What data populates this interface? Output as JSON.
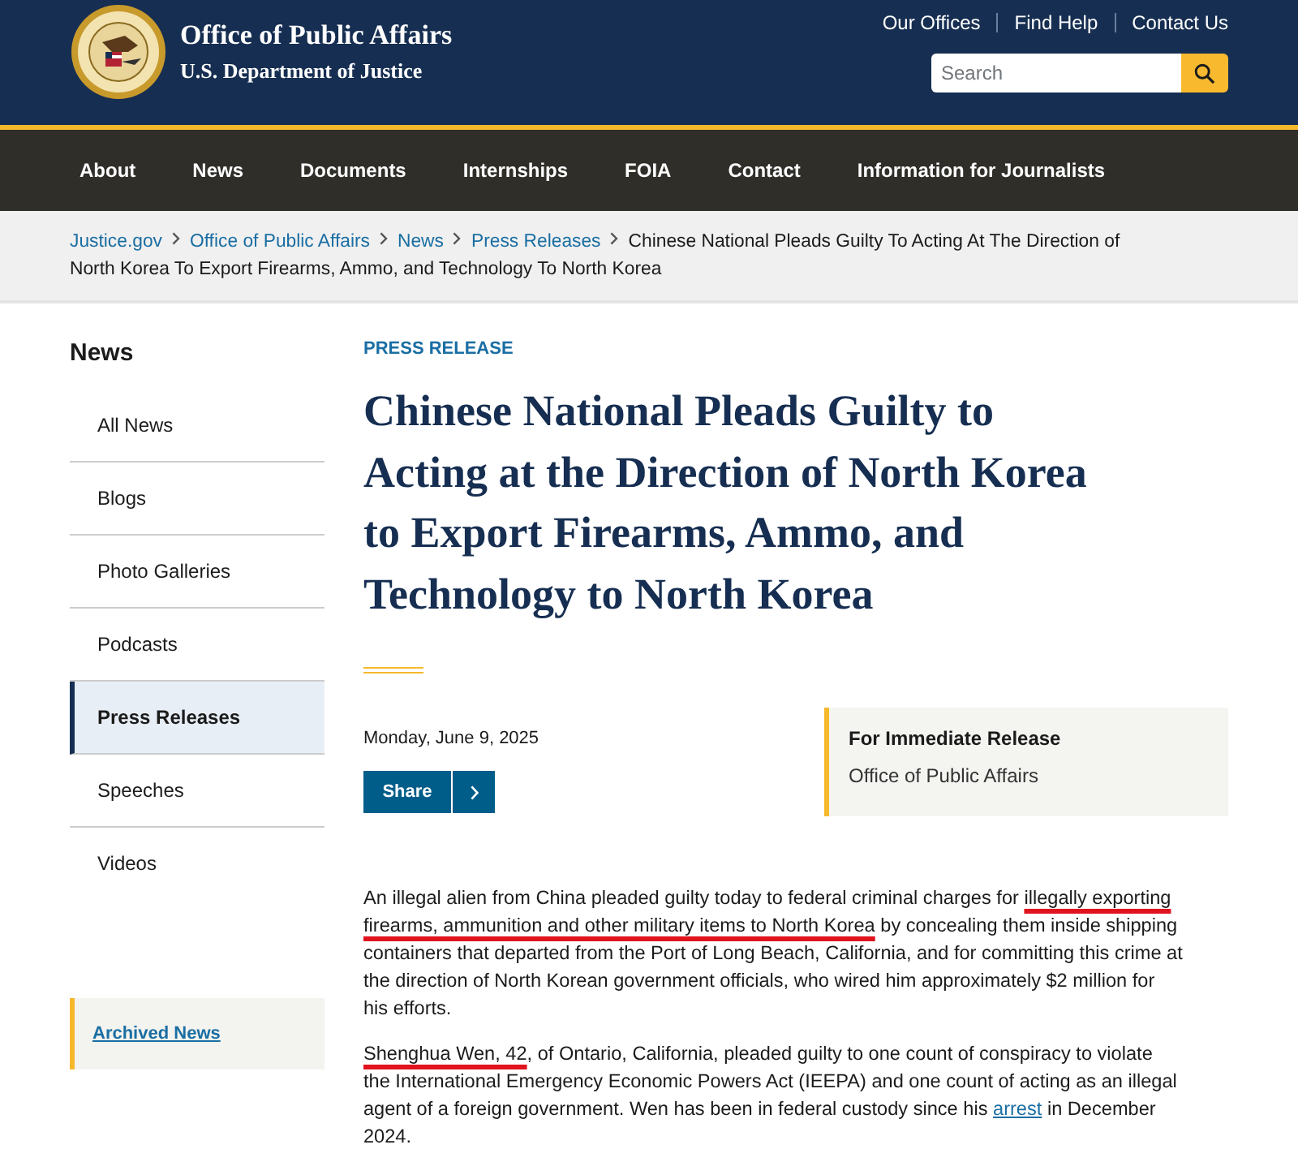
{
  "header": {
    "title": "Office of Public Affairs",
    "subtitle": "U.S. Department of Justice",
    "utility_links": [
      "Our Offices",
      "Find Help",
      "Contact Us"
    ],
    "search": {
      "placeholder": "Search"
    }
  },
  "nav": [
    "About",
    "News",
    "Documents",
    "Internships",
    "FOIA",
    "Contact",
    "Information for Journalists"
  ],
  "breadcrumb": {
    "links": [
      "Justice.gov",
      "Office of Public Affairs",
      "News",
      "Press Releases"
    ],
    "current": [
      "Chinese National Pleads Guilty To Acting At The Direction of",
      "North Korea To Export Firearms, Ammo, and Technology To North Korea"
    ]
  },
  "sidebar": {
    "heading": "News",
    "items": [
      {
        "label": "All News",
        "selected": false
      },
      {
        "label": "Blogs",
        "selected": false
      },
      {
        "label": "Photo Galleries",
        "selected": false
      },
      {
        "label": "Podcasts",
        "selected": false
      },
      {
        "label": "Press Releases",
        "selected": true
      },
      {
        "label": "Speeches",
        "selected": false
      },
      {
        "label": "Videos",
        "selected": false
      }
    ],
    "archive_link": "Archived News"
  },
  "article": {
    "eyebrow": "PRESS RELEASE",
    "title": "Chinese National Pleads Guilty to Acting at the Direction of North Korea to Export Firearms, Ammo, and Technology to North Korea",
    "date": "Monday, June 9, 2025",
    "share": "Share",
    "release_box": {
      "heading": "For Immediate Release",
      "office": "Office of Public Affairs"
    },
    "paragraphs": [
      [
        {
          "kind": "plain",
          "text": "An illegal alien from China pleaded guilty today to federal criminal charges for "
        },
        {
          "kind": "marked",
          "text": "illegally exporting firearms, ammunition and other military items to North Korea"
        },
        {
          "kind": "plain",
          "text": " by concealing them inside shipping containers that departed from the Port of Long Beach, California, and for committing this crime at the direction of North Korean government officials, who wired him approximately $2 million for his efforts."
        }
      ],
      [
        {
          "kind": "marked",
          "text": "Shenghua Wen, 42"
        },
        {
          "kind": "plain",
          "text": ", of Ontario, California, pleaded guilty to one count of conspiracy to violate the International Emergency Economic Powers Act (IEEPA) and one count of acting as an illegal agent of a foreign government. Wen has been in federal custody since his "
        },
        {
          "kind": "link",
          "text": "arrest"
        },
        {
          "kind": "plain",
          "text": " in December 2024."
        }
      ]
    ]
  }
}
